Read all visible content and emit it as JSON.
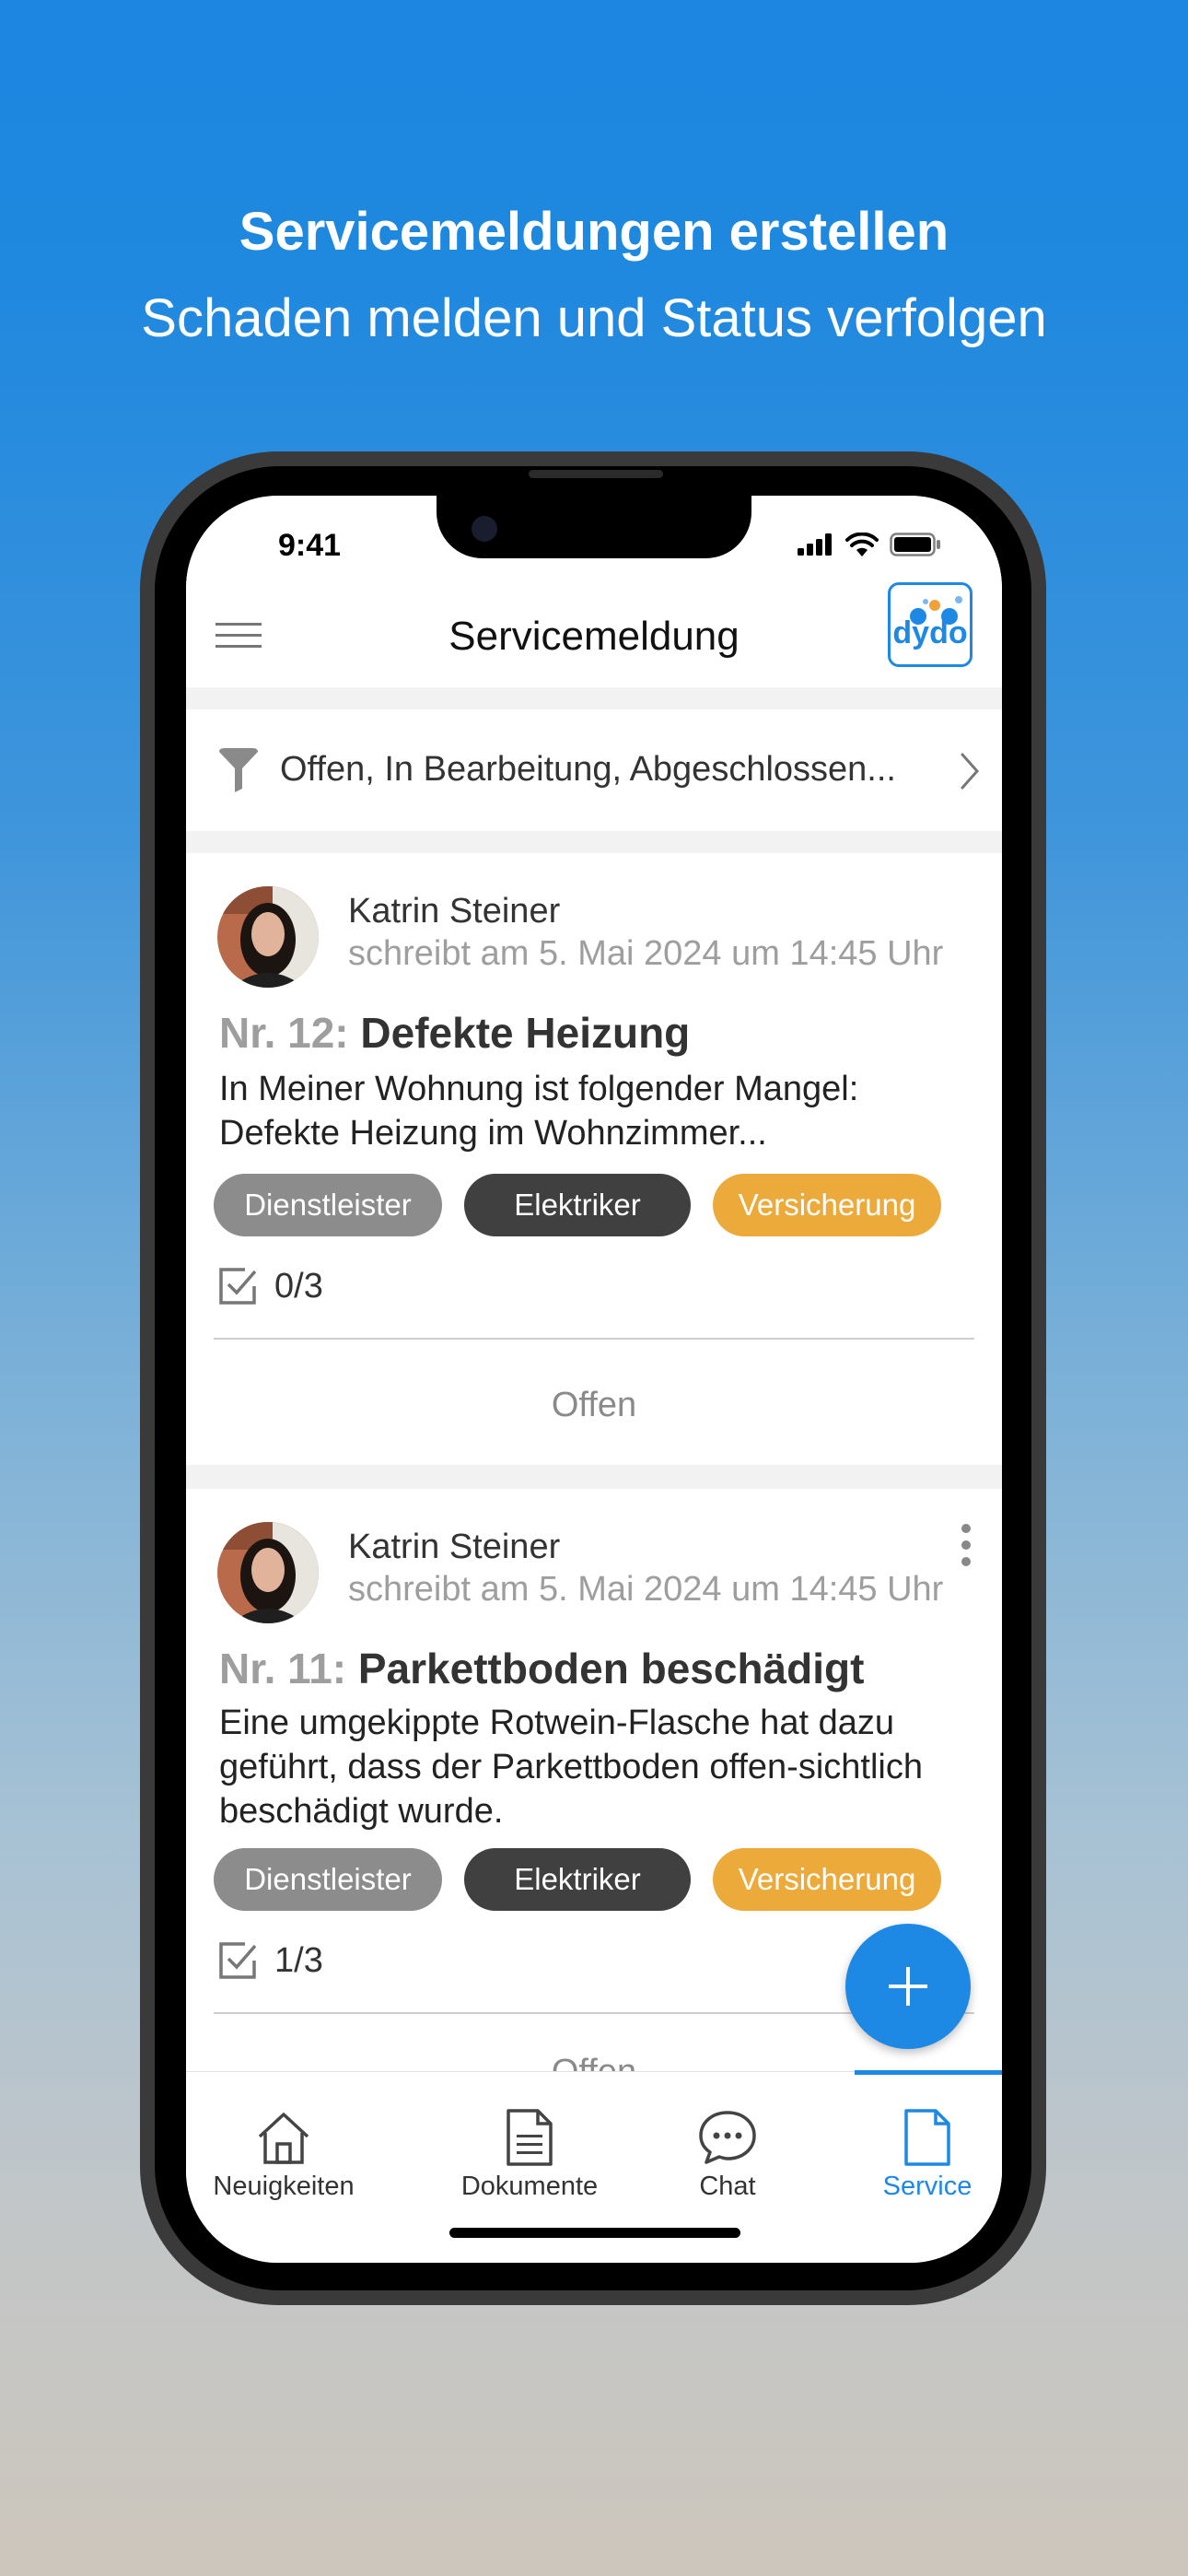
{
  "hero": {
    "title": "Servicemeldungen erstellen",
    "subtitle": "Schaden melden und Status verfolgen"
  },
  "statusbar": {
    "time": "9:41"
  },
  "appbar": {
    "title": "Servicemeldung",
    "logo_text": "dydo"
  },
  "filter": {
    "text": "Offen, In Bearbeitung, Abgeschlossen..."
  },
  "cards": [
    {
      "author": "Katrin Steiner",
      "meta": "schreibt am 5. Mai 2024 um 14:45 Uhr",
      "number": "Nr. 12:",
      "title": "Defekte Heizung",
      "body": "In Meiner Wohnung ist folgender Mangel: Defekte Heizung im Wohnzimmer...",
      "chips": [
        "Dienstleister",
        "Elektriker",
        "Versicherung"
      ],
      "tasks": "0/3",
      "status": "Offen"
    },
    {
      "author": "Katrin Steiner",
      "meta": "schreibt am 5. Mai 2024 um 14:45 Uhr",
      "number": "Nr. 11:",
      "title": "Parkettboden beschädigt",
      "body": "Eine umgekippte Rotwein-Flasche hat dazu geführt, dass der Parkettboden offen-sichtlich beschädigt wurde.",
      "chips": [
        "Dienstleister",
        "Elektriker",
        "Versicherung"
      ],
      "tasks": "1/3",
      "status": "Offen"
    }
  ],
  "tabs": [
    {
      "label": "Neuigkeiten",
      "icon": "home-icon"
    },
    {
      "label": "Dokumente",
      "icon": "document-icon"
    },
    {
      "label": "Chat",
      "icon": "chat-icon"
    },
    {
      "label": "Service",
      "icon": "service-document-icon",
      "active": true
    }
  ],
  "colors": {
    "accent": "#1e88e5",
    "chip_gray": "#8c8c8c",
    "chip_dark": "#404040",
    "chip_orange": "#ecaa3b"
  }
}
